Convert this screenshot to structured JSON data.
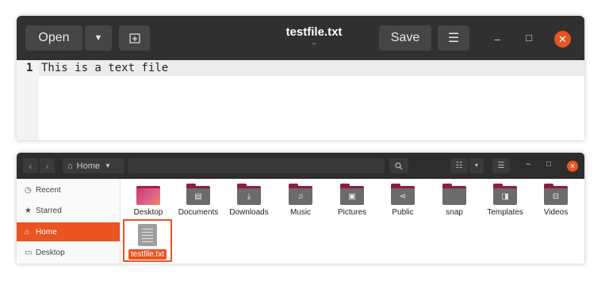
{
  "editor": {
    "open_label": "Open",
    "title": "testfile.txt",
    "subtitle": "~",
    "save_label": "Save",
    "line_number": "1",
    "line_text": "This is a text file"
  },
  "files": {
    "location": "Home",
    "sidebar": [
      {
        "label": "Recent",
        "icon": "clock-icon"
      },
      {
        "label": "Starred",
        "icon": "star-icon"
      },
      {
        "label": "Home",
        "icon": "home-icon"
      },
      {
        "label": "Desktop",
        "icon": "desktop-icon"
      }
    ],
    "folders": [
      "Desktop",
      "Documents",
      "Downloads",
      "Music",
      "Pictures",
      "Public",
      "snap",
      "Templates",
      "Videos"
    ],
    "selected_file": "testfile.txt"
  },
  "colors": {
    "accent": "#e95420",
    "headerbar": "#303030",
    "folder": "#6b6b6b"
  }
}
